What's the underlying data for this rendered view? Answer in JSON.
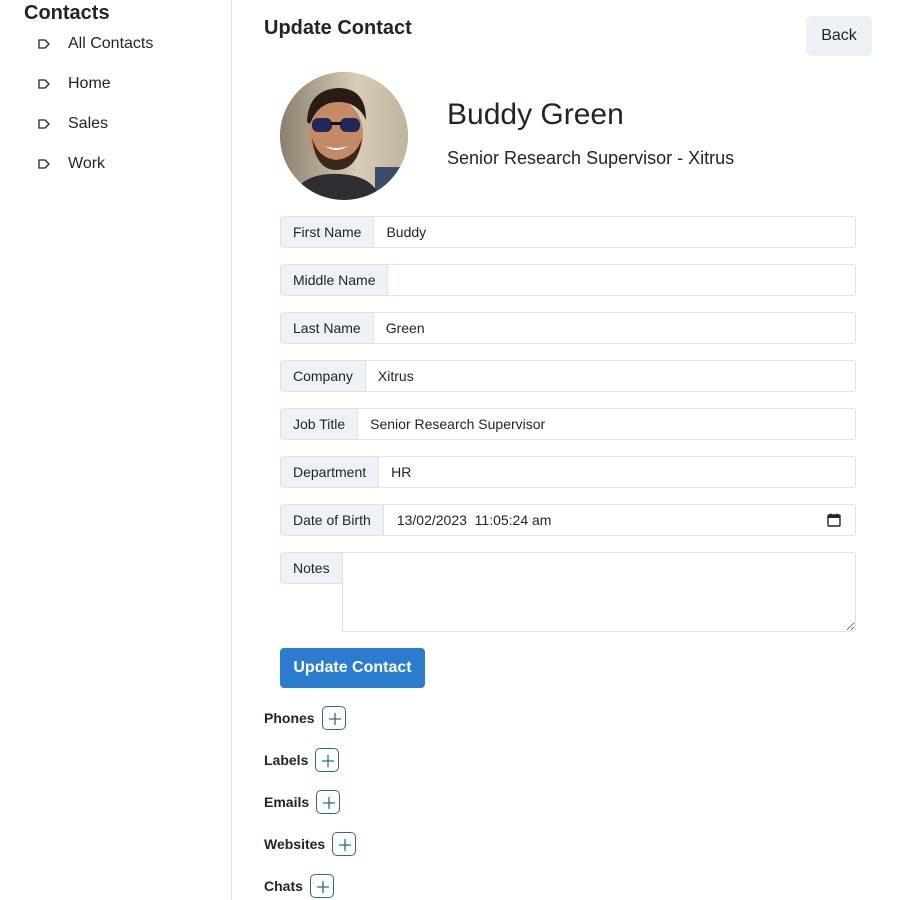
{
  "sidebar": {
    "title": "Contacts",
    "items": [
      {
        "label": "All Contacts",
        "icon": "tag-icon"
      },
      {
        "label": "Home",
        "icon": "tag-icon"
      },
      {
        "label": "Sales",
        "icon": "tag-icon"
      },
      {
        "label": "Work",
        "icon": "tag-icon"
      }
    ]
  },
  "header": {
    "title": "Update Contact",
    "back_label": "Back"
  },
  "contact": {
    "name": "Buddy Green",
    "subtitle": "Senior Research Supervisor - Xitrus"
  },
  "form": {
    "first_name": {
      "label": "First Name",
      "value": "Buddy"
    },
    "middle_name": {
      "label": "Middle Name",
      "value": ""
    },
    "last_name": {
      "label": "Last Name",
      "value": "Green"
    },
    "company": {
      "label": "Company",
      "value": "Xitrus"
    },
    "job_title": {
      "label": "Job Title",
      "value": "Senior Research Supervisor"
    },
    "department": {
      "label": "Department",
      "value": "HR"
    },
    "date_of_birth": {
      "label": "Date of Birth",
      "value": "13/02/2023  11:05:24 am"
    },
    "notes": {
      "label": "Notes",
      "value": ""
    },
    "submit_label": "Update Contact"
  },
  "sections": {
    "phones": "Phones",
    "labels": "Labels",
    "emails": "Emails",
    "websites": "Websites",
    "chats": "Chats"
  },
  "colors": {
    "primary": "#2b7ccf",
    "back_bg": "#edf1f5",
    "label_bg": "#eef1f5",
    "border": "#dee2e6"
  }
}
